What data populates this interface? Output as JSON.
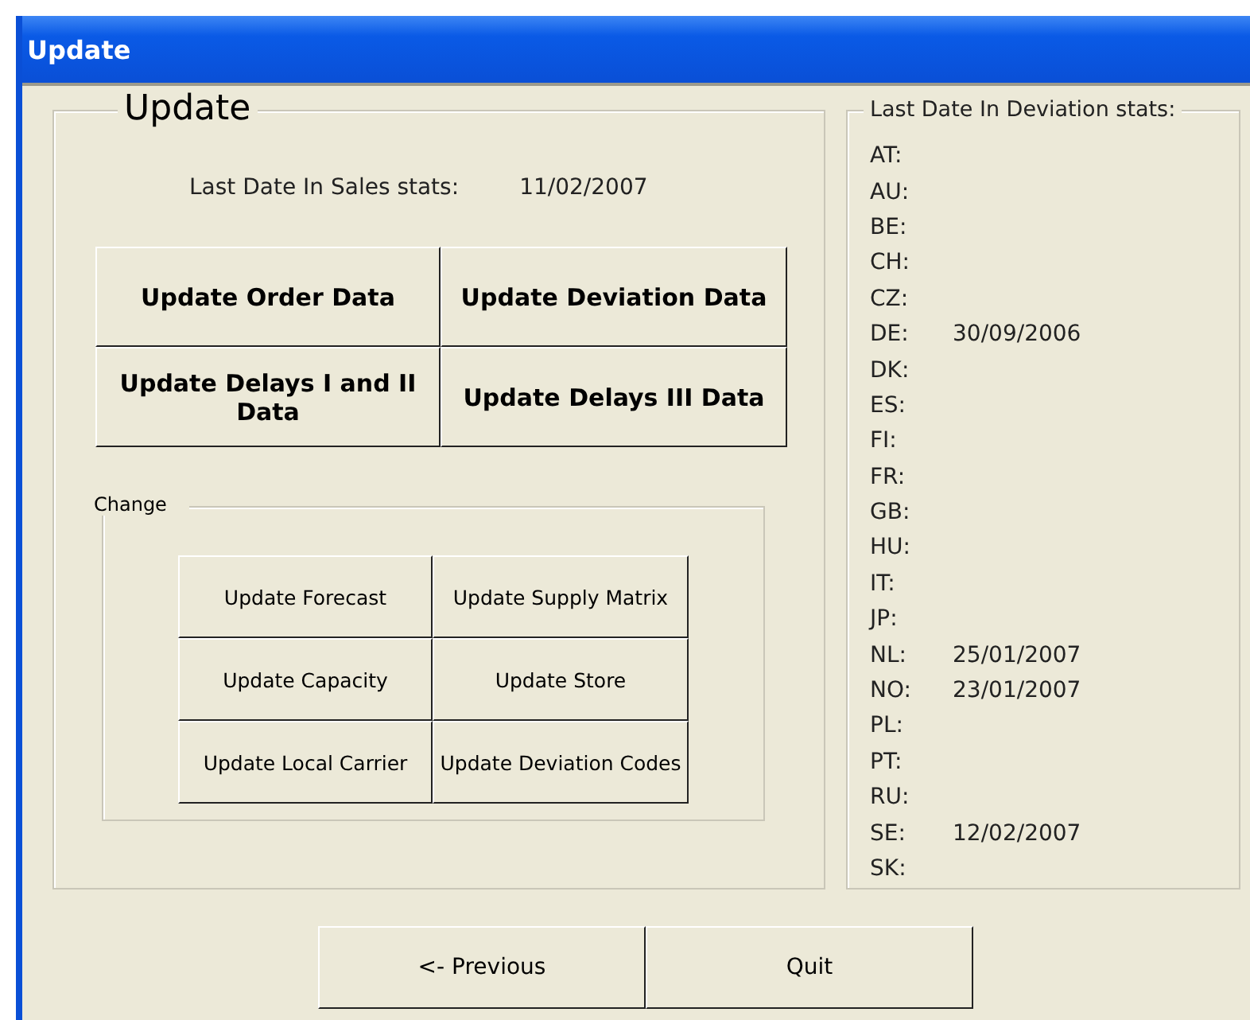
{
  "window": {
    "title": "Update"
  },
  "update_group": {
    "title": "Update",
    "sales_label": "Last Date In Sales stats:",
    "sales_date": "11/02/2007",
    "buttons": [
      "Update Order Data",
      "Update Deviation Data",
      "Update Delays I and II Data",
      "Update Delays III Data"
    ]
  },
  "change_group": {
    "title": "Change",
    "buttons": [
      "Update Forecast",
      "Update Supply Matrix",
      "Update Capacity",
      "Update Store",
      "Update Local Carrier",
      "Update Deviation Codes"
    ]
  },
  "deviation_group": {
    "title": "Last Date In Deviation stats:",
    "rows": [
      {
        "code": "AT:"
      },
      {
        "code": "AU:"
      },
      {
        "code": "BE:"
      },
      {
        "code": "CH:"
      },
      {
        "code": "CZ:"
      },
      {
        "code": "DE:",
        "date": "30/09/2006"
      },
      {
        "code": "DK:"
      },
      {
        "code": "ES:"
      },
      {
        "code": "FI:"
      },
      {
        "code": "FR:"
      },
      {
        "code": "GB:"
      },
      {
        "code": "HU:"
      },
      {
        "code": "IT:"
      },
      {
        "code": "JP:"
      },
      {
        "code": "NL:",
        "date": "25/01/2007"
      },
      {
        "code": "NO:",
        "date": "23/01/2007"
      },
      {
        "code": "PL:"
      },
      {
        "code": "PT:"
      },
      {
        "code": "RU:"
      },
      {
        "code": "SE:",
        "date": "12/02/2007"
      },
      {
        "code": "SK:"
      }
    ]
  },
  "footer_buttons": [
    "<- Previous",
    "Quit"
  ]
}
